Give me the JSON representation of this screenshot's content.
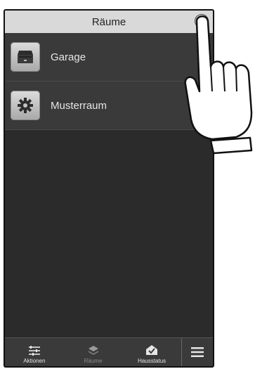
{
  "header": {
    "title": "Räume"
  },
  "rooms": [
    {
      "label": "Garage",
      "icon": "garage-icon"
    },
    {
      "label": "Musterraum",
      "icon": "gear-icon"
    }
  ],
  "tabbar": {
    "tabs": [
      {
        "label": "Aktionen",
        "icon": "sliders-icon",
        "active": true
      },
      {
        "label": "Räume",
        "icon": "room-icon",
        "active": false
      },
      {
        "label": "Hausstatus",
        "icon": "house-check-icon",
        "active": true
      }
    ],
    "menu_icon": "hamburger-menu-icon"
  },
  "colors": {
    "header_bg": "#d9d9d9",
    "screen_bg": "#2b2b2b",
    "list_item_bg": "#3a3a3a"
  }
}
